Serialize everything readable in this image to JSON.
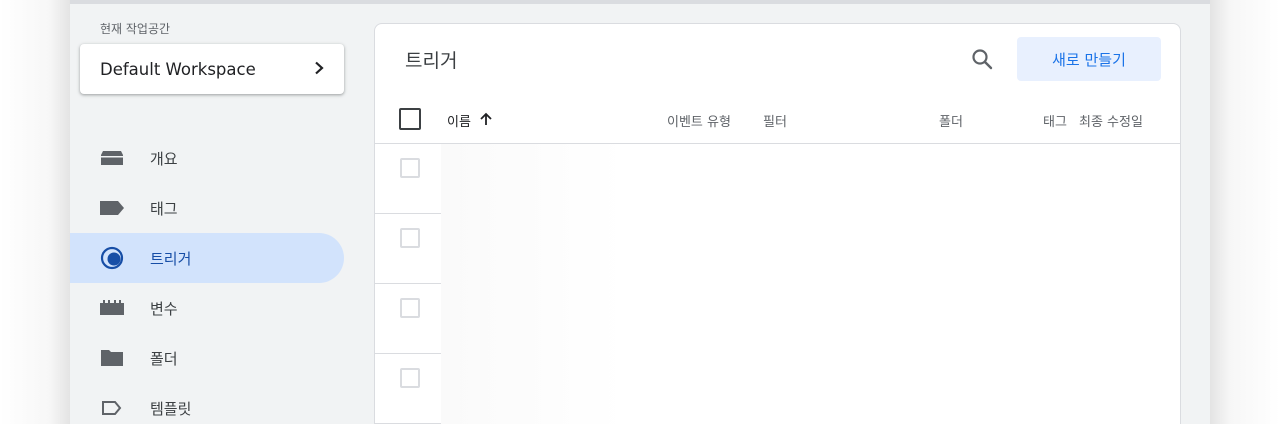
{
  "sidebar": {
    "workspace_caption": "현재 작업공간",
    "workspace_name": "Default Workspace",
    "items": [
      {
        "label": "개요",
        "icon": "overview-icon",
        "active": false
      },
      {
        "label": "태그",
        "icon": "tag-icon",
        "active": false
      },
      {
        "label": "트리거",
        "icon": "trigger-icon",
        "active": true
      },
      {
        "label": "변수",
        "icon": "variable-icon",
        "active": false
      },
      {
        "label": "폴더",
        "icon": "folder-icon",
        "active": false
      },
      {
        "label": "템플릿",
        "icon": "template-icon",
        "active": false
      }
    ]
  },
  "main": {
    "title": "트리거",
    "new_button_label": "새로 만들기",
    "columns": {
      "name": "이름",
      "event_type": "이벤트 유형",
      "filter": "필터",
      "folder": "폴더",
      "tags": "태그",
      "last_edited": "최종 수정일"
    },
    "rows": [
      "",
      "",
      "",
      ""
    ]
  },
  "colors": {
    "accent": "#1a73e8",
    "active_nav_bg": "#d2e3fc",
    "active_nav_text": "#174ea6",
    "app_bg": "#f1f3f4"
  }
}
